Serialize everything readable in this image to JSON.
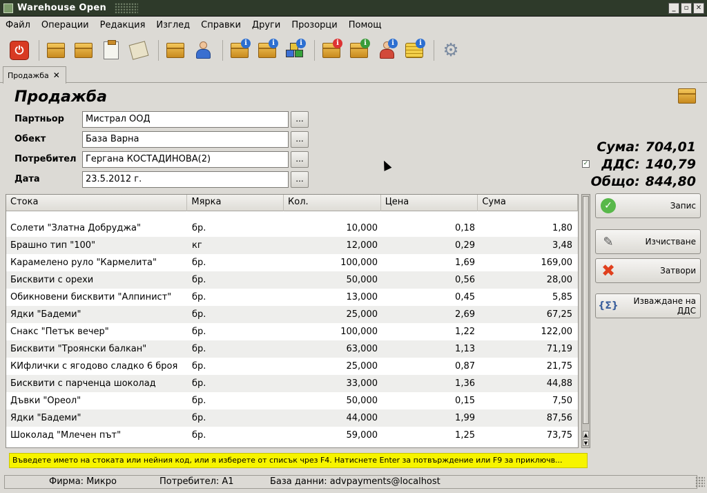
{
  "window": {
    "title": "Warehouse Open",
    "controls": [
      "_",
      "▫",
      "✕"
    ]
  },
  "menu": [
    "Файл",
    "Операции",
    "Редакция",
    "Изглед",
    "Справки",
    "Други",
    "Прозорци",
    "Помощ"
  ],
  "tab": {
    "label": "Продажба",
    "close": "✕"
  },
  "form": {
    "title": "Продажба",
    "browse": "...",
    "partner_label": "Партньор",
    "partner_value": "Мистрал ООД",
    "object_label": "Обект",
    "object_value": "База Варна",
    "consumer_label": "Потребител",
    "consumer_value": "Гергана КОСТАДИНОВА(2)",
    "date_label": "Дата",
    "date_value": "23.5.2012 г."
  },
  "totals": {
    "sum_label": "Сума:",
    "sum_value": "704,01",
    "vat_label": "ДДС:",
    "vat_value": "140,79",
    "vat_checked": "✓",
    "total_label": "Общо:",
    "total_value": "844,80"
  },
  "table": {
    "headers": [
      "Стока",
      "Мярка",
      "Кол.",
      "Цена",
      "Сума"
    ],
    "rows": [
      [
        "Солети \"Златна Добруджа\"",
        "бр.",
        "10,000",
        "0,18",
        "1,80"
      ],
      [
        "Брашно тип \"100\"",
        "кг",
        "12,000",
        "0,29",
        "3,48"
      ],
      [
        "Карамелено руло \"Кармелита\"",
        "бр.",
        "100,000",
        "1,69",
        "169,00"
      ],
      [
        "Бисквити с орехи",
        "бр.",
        "50,000",
        "0,56",
        "28,00"
      ],
      [
        "Обикновени бисквити \"Алпинист\"",
        "бр.",
        "13,000",
        "0,45",
        "5,85"
      ],
      [
        "Ядки \"Бадеми\"",
        "бр.",
        "25,000",
        "2,69",
        "67,25"
      ],
      [
        "Снакс \"Петък вечер\"",
        "бр.",
        "100,000",
        "1,22",
        "122,00"
      ],
      [
        "Бисквити \"Троянски балкан\"",
        "бр.",
        "63,000",
        "1,13",
        "71,19"
      ],
      [
        "КИфлички с ягодово сладко 6 броя",
        "бр.",
        "25,000",
        "0,87",
        "21,75"
      ],
      [
        "Бисквити с парченца шоколад",
        "бр.",
        "33,000",
        "1,36",
        "44,88"
      ],
      [
        "Дъвки \"Ореол\"",
        "бр.",
        "50,000",
        "0,15",
        "7,50"
      ],
      [
        "Ядки \"Бадеми\"",
        "бр.",
        "44,000",
        "1,99",
        "87,56"
      ],
      [
        "Шоколад \"Млечен път\"",
        "бр.",
        "59,000",
        "1,25",
        "73,75"
      ]
    ]
  },
  "actions": {
    "save": "Запис",
    "clear": "Изчистване",
    "close": "Затвори",
    "vat_extract": "Изваждане на ДДС"
  },
  "hint": "Въведете името на стоката или нейния код, или я изберете от списък чрез F4. Натиснете Enter за потвърждение или F9 за приключв...",
  "status": {
    "company": "Фирма: Микро",
    "user": "Потребител: A1",
    "database": "База данни: advpayments@localhost"
  }
}
